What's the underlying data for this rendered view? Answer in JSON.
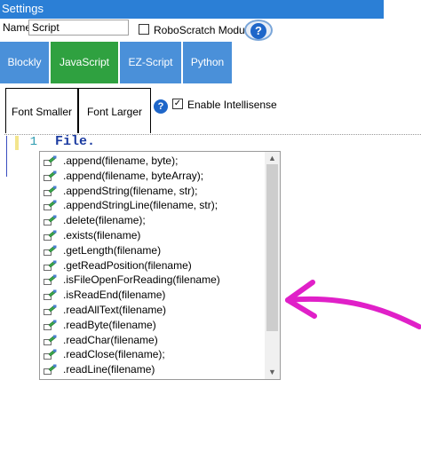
{
  "window": {
    "title": "Settings"
  },
  "form": {
    "name_label": "Name",
    "name_value": "Script",
    "roboscratch_label": "RoboScratch Module",
    "help_glyph": "?"
  },
  "tabs": [
    {
      "label": "Blockly",
      "color": "#4a90d9"
    },
    {
      "label": "JavaScript",
      "color": "#2fa140",
      "active": true
    },
    {
      "label": "EZ-Script",
      "color": "#4a90d9"
    },
    {
      "label": "Python",
      "color": "#4a90d9"
    }
  ],
  "toolbar": {
    "font_smaller": "Font Smaller",
    "font_larger": "Font Larger",
    "intellisense_label": "Enable Intellisense",
    "intellisense_checked": true,
    "check_glyph": "✓"
  },
  "editor": {
    "line_number": "1",
    "code": "File."
  },
  "autocomplete": {
    "items": [
      ".append(filename, byte);",
      ".append(filename, byteArray);",
      ".appendString(filename, str);",
      ".appendStringLine(filename, str);",
      ".delete(filename);",
      ".exists(filename)",
      ".getLength(filename)",
      ".getReadPosition(filename)",
      ".isFileOpenForReading(filename)",
      ".isReadEnd(filename)",
      ".readAllText(filename)",
      ".readByte(filename)",
      ".readChar(filename)",
      ".readClose(filename);",
      ".readLine(filename)"
    ],
    "item_icon": "method-icon",
    "scroll_up_glyph": "▲",
    "scroll_down_glyph": "▼"
  },
  "annotation": {
    "arrow_color": "#e020c8"
  }
}
